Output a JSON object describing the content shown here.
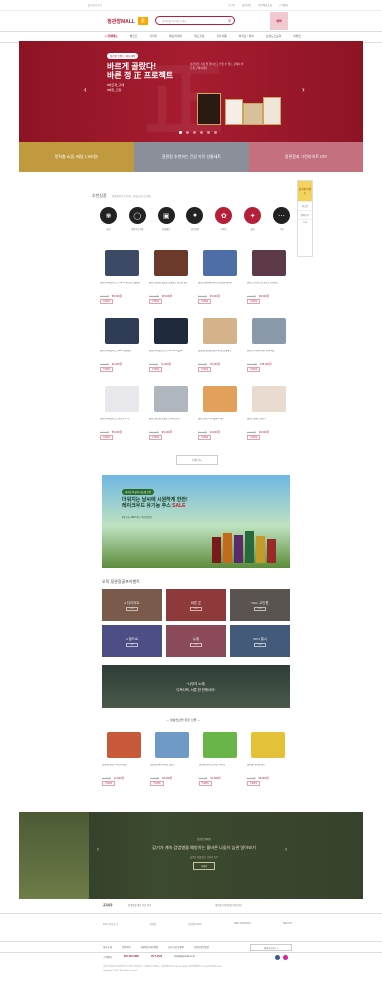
{
  "topbar": {
    "left": "즐겨찾기추가",
    "links": [
      "로그인",
      "회원가입",
      "주문배송조회",
      "고객센터"
    ]
  },
  "header": {
    "logo": "정관장MALL",
    "logo_tag": "正",
    "search_placeholder": "검색어를 입력해 주세요",
    "search_icon": "magnifier-icon",
    "side_banner": "혜택"
  },
  "gnb": {
    "items": [
      "≡ 전체메뉴",
      "베스트",
      "기획전",
      "에브리데이",
      "레드홍삼",
      "건강식품",
      "라이프 / 뷰티",
      "브랜드스토어",
      "이벤트"
    ]
  },
  "hero": {
    "badge": "정관장 브랜드 최대 혜택",
    "title": "바르게 골랐다!\n바른 정 正 프로젝트",
    "sub": "#바르게_구매\n#바른_건강",
    "desc": "정관장을 가장 잘 알아보고 믿을 수 있는 곳에서 바르게 구매하세요",
    "big_char": "正",
    "slides": 6
  },
  "tri_banners": [
    {
      "text": "정직충 쇼핑, 쎄일 1,300원!",
      "color": "#c19a3f"
    },
    {
      "text": "정관장 추천하는 건강 가득 선물세트",
      "color": "#8a8f9a"
    },
    {
      "text": "정관장과 그린라이트 ON!",
      "color": "#c4707e"
    }
  ],
  "recommend": {
    "title": "추천상품",
    "subtitle": "정관장에서 추천하는 상품을 만나보세요",
    "categories": [
      {
        "label": "홍삼",
        "icon": "ginseng-icon"
      },
      {
        "label": "건강기능식품",
        "icon": "bottle-icon"
      },
      {
        "label": "선물세트",
        "icon": "gift-icon"
      },
      {
        "label": "골프용품",
        "icon": "golf-ball-icon"
      },
      {
        "label": "라이프",
        "icon": "leaf-icon"
      },
      {
        "label": "뷰티",
        "icon": "beauty-icon"
      },
      {
        "label": "기타",
        "icon": "more-icon"
      }
    ]
  },
  "side_quick": {
    "ad": "정관장 이벤트",
    "links": [
      "최근본",
      "장바구니",
      "TOP"
    ]
  },
  "products": [
    {
      "name": "[골프] 타이틀리스트 Pro V1 골프공 선물세트",
      "price": "58,000원",
      "orig": "68,000원",
      "tag": "무료배송",
      "color": "#3d4a66"
    },
    {
      "name": "[골프] 정관장 홍삼정 선물세트 골프공 세트",
      "price": "98,000원",
      "orig": "120,000원",
      "tag": "무료배송",
      "color": "#6b3a2a"
    },
    {
      "name": "[골프] 캘러웨이 골프공 정관장 에디션",
      "price": "45,000원",
      "orig": "52,000원",
      "tag": "무료배송",
      "color": "#4f6ea8"
    },
    {
      "name": "[골프] 브리지스톤 골프공 기획세트",
      "price": "39,000원",
      "orig": "45,000원",
      "tag": "무료배송",
      "color": "#5c3a4a"
    },
    {
      "name": "[골프] 타이틀리스트 AVX 선물세트",
      "price": "62,000원",
      "orig": "70,000원",
      "tag": "무료배송",
      "color": "#2f3c55"
    },
    {
      "name": "[골프] 타이틀리스트 Pro V1x 더블팩",
      "price": "72,000원",
      "orig": "80,000원",
      "tag": "무료배송",
      "color": "#1f2a3d"
    },
    {
      "name": "[정관장] 홍삼정 에브리타임 선물세트",
      "price": "79,000원",
      "orig": "88,000원",
      "tag": "무료배송",
      "color": "#d4b28a"
    },
    {
      "name": "[골프] 드라이버 헤드 커버 세트",
      "price": "135,000원",
      "orig": "150,000원",
      "tag": "무료배송",
      "color": "#8a9aaa"
    },
    {
      "name": "[골프] 타이틀리스트 골프공 12구",
      "price": "55,000원",
      "orig": "60,000원",
      "tag": "무료배송",
      "color": "#e8e8ec"
    },
    {
      "name": "[골프] 골프화 남성용 스파이크리스",
      "price": "89,000원",
      "orig": "110,000원",
      "tag": "무료배송",
      "color": "#b0b6bd"
    },
    {
      "name": "[골프] 골프 티 & 볼마커 세트",
      "price": "19,000원",
      "orig": "25,000원",
      "tag": "무료배송",
      "color": "#e3a05a"
    },
    {
      "name": "[골프] 라켓형 연습기",
      "price": "29,000원",
      "orig": "35,000원",
      "tag": "무료배송",
      "color": "#eadbd0"
    }
  ],
  "more_button": "더보기 +",
  "promo": {
    "pill": "라이프 & 뷰티 리뉴얼 오픈",
    "title_a": "더워지는 날씨에 시원하게 한잔!",
    "title_b": "레이크우드 유기농 주스 ",
    "title_sale": "SALE",
    "desc": "#유기농 #NFC주스 #건강음료"
  },
  "golf": {
    "title": "오직 정관장골프이벤트",
    "tiles": [
      {
        "label": "# 다이어트",
        "color": "#7a5a4a"
      },
      {
        "label": "바른 正",
        "color": "#8e3a3a"
      },
      {
        "label": "NGL 고인원",
        "color": "#5a5450"
      },
      {
        "label": "# 필드로",
        "color": "#4e4e86"
      },
      {
        "label": "뉴필",
        "color": "#8a4a5a"
      },
      {
        "label": "NEO 출시",
        "color": "#445a7a"
      }
    ],
    "go": "GO"
  },
  "quote": "\"나부의 노래,\n다독다독, 서툰 한 번에서러\"",
  "life": {
    "title": "— 생활습관을 위한 선물 —",
    "items": [
      {
        "name": "[정관장] 홍삼 아이스티 세트",
        "price": "12,900원",
        "orig": "15,000원",
        "tag": "무료배송",
        "color": "#c85a3a"
      },
      {
        "name": "[정관장] 에브리타임 밸런스",
        "price": "49,000원",
        "orig": "55,000원",
        "tag": "무료배송",
        "color": "#6f9ac8"
      },
      {
        "name": "[정관장] 알파프로젝트 비타민",
        "price": "32,000원",
        "orig": "38,000원",
        "tag": "무료배송",
        "color": "#6ab54a"
      },
      {
        "name": "[정관장] 홍삼톤 골드",
        "price": "68,000원",
        "orig": "75,000원",
        "tag": "무료배송",
        "color": "#e3c23a"
      }
    ]
  },
  "campaign": {
    "small": "정관장 캠페인",
    "title": "감기가 계속 감염병을 예방하는 올바른 나들이 습관 알아보기",
    "desc": "올바른 생활습관, 건강한 하루",
    "button": "자세히"
  },
  "footer": {
    "notice_label": "공지사항",
    "notice_text": "정관장몰 배송 지연 안내",
    "notice_text2": "개인정보처리방침 변경 안내",
    "partners": [
      "KGC 인삼공사",
      "정관장",
      "정관장 GOLF",
      "RED GINSENG",
      "HEALTH"
    ],
    "links": [
      "회사소개",
      "이용약관",
      "개인정보처리방침",
      "청소년보호정책",
      "사업자정보확인"
    ],
    "family": "패밀리사이트 ▾",
    "cs_label": "고객센터",
    "cs_phone": "080-433-0988",
    "cs_phone2": "1577-2525",
    "cs_mail": "help@kgcmall.co.kr",
    "address": "(주)한국인삼공사 대전광역시 대덕구 벚꽃길 71 | 대표이사 김재수 | 사업자등록번호 305-81-63860 | 통신판매업신고 2018-대전대덕-0061\nCopyright © KGC. All rights reserved."
  }
}
